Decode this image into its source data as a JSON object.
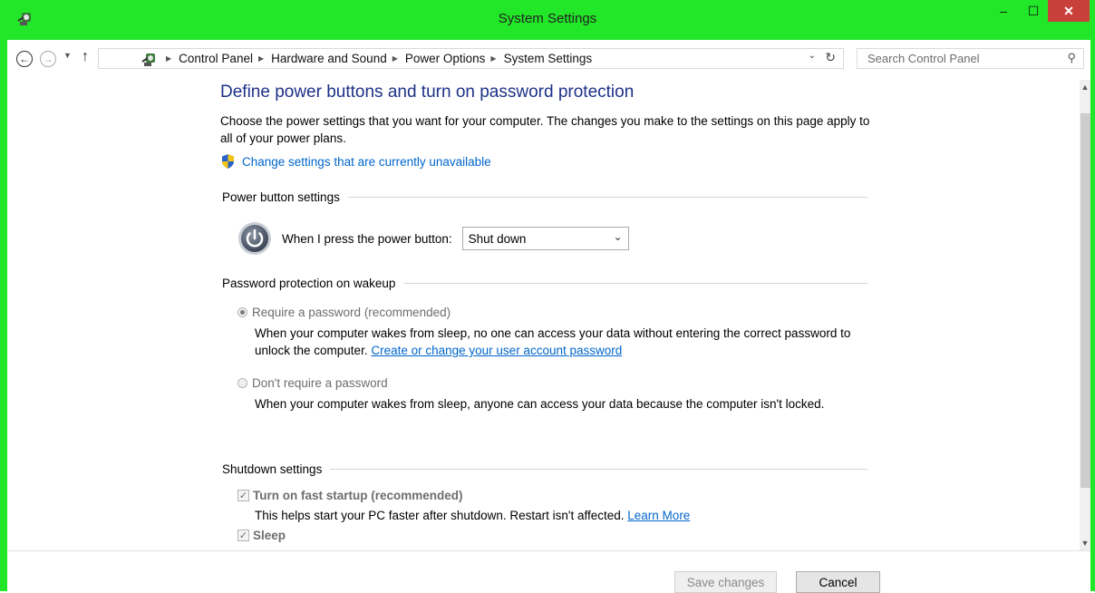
{
  "window": {
    "title": "System Settings",
    "min_glyph": "–",
    "max_glyph": "☐",
    "close_glyph": "✕",
    "accent_color": "#22e628",
    "close_color": "#c9403a"
  },
  "toolbar": {
    "back_glyph": "←",
    "forward_glyph": "→",
    "recent_glyph": "▼",
    "up_glyph": "↑",
    "breadcrumb": [
      "Control Panel",
      "Hardware and Sound",
      "Power Options",
      "System Settings"
    ],
    "crumb_separator": "▶",
    "dropdown_glyph": "⌄",
    "refresh_glyph": "↻",
    "search_placeholder": "Search Control Panel",
    "search_glyph": "⚲"
  },
  "main": {
    "title": "Define power buttons and turn on password protection",
    "intro": "Choose the power settings that you want for your computer. The changes you make to the settings on this page apply to all of your power plans.",
    "admin_link": "Change settings that are currently unavailable",
    "power_section": {
      "heading": "Power button settings",
      "label": "When I press the power button:",
      "selected": "Shut down",
      "chevron": "⌄"
    },
    "password_section": {
      "heading": "Password protection on wakeup",
      "require_label": "Require a password (recommended)",
      "require_desc": "When your computer wakes from sleep, no one can access your data without entering the correct password to unlock the computer.",
      "require_link": "Create or change your user account password",
      "norequire_label": "Don't require a password",
      "norequire_desc": "When your computer wakes from sleep, anyone can access your data because the computer isn't locked.",
      "selected": "require"
    },
    "shutdown_section": {
      "heading": "Shutdown settings",
      "fast_label": "Turn on fast startup (recommended)",
      "fast_desc": "This helps start your PC faster after shutdown. Restart isn't affected.",
      "fast_link": "Learn More",
      "fast_checked": true,
      "sleep_label": "Sleep",
      "sleep_checked": true,
      "check_glyph": "✓"
    }
  },
  "scrollbar": {
    "up_glyph": "▲",
    "down_glyph": "▼"
  },
  "footer": {
    "save_label": "Save changes",
    "cancel_label": "Cancel"
  }
}
